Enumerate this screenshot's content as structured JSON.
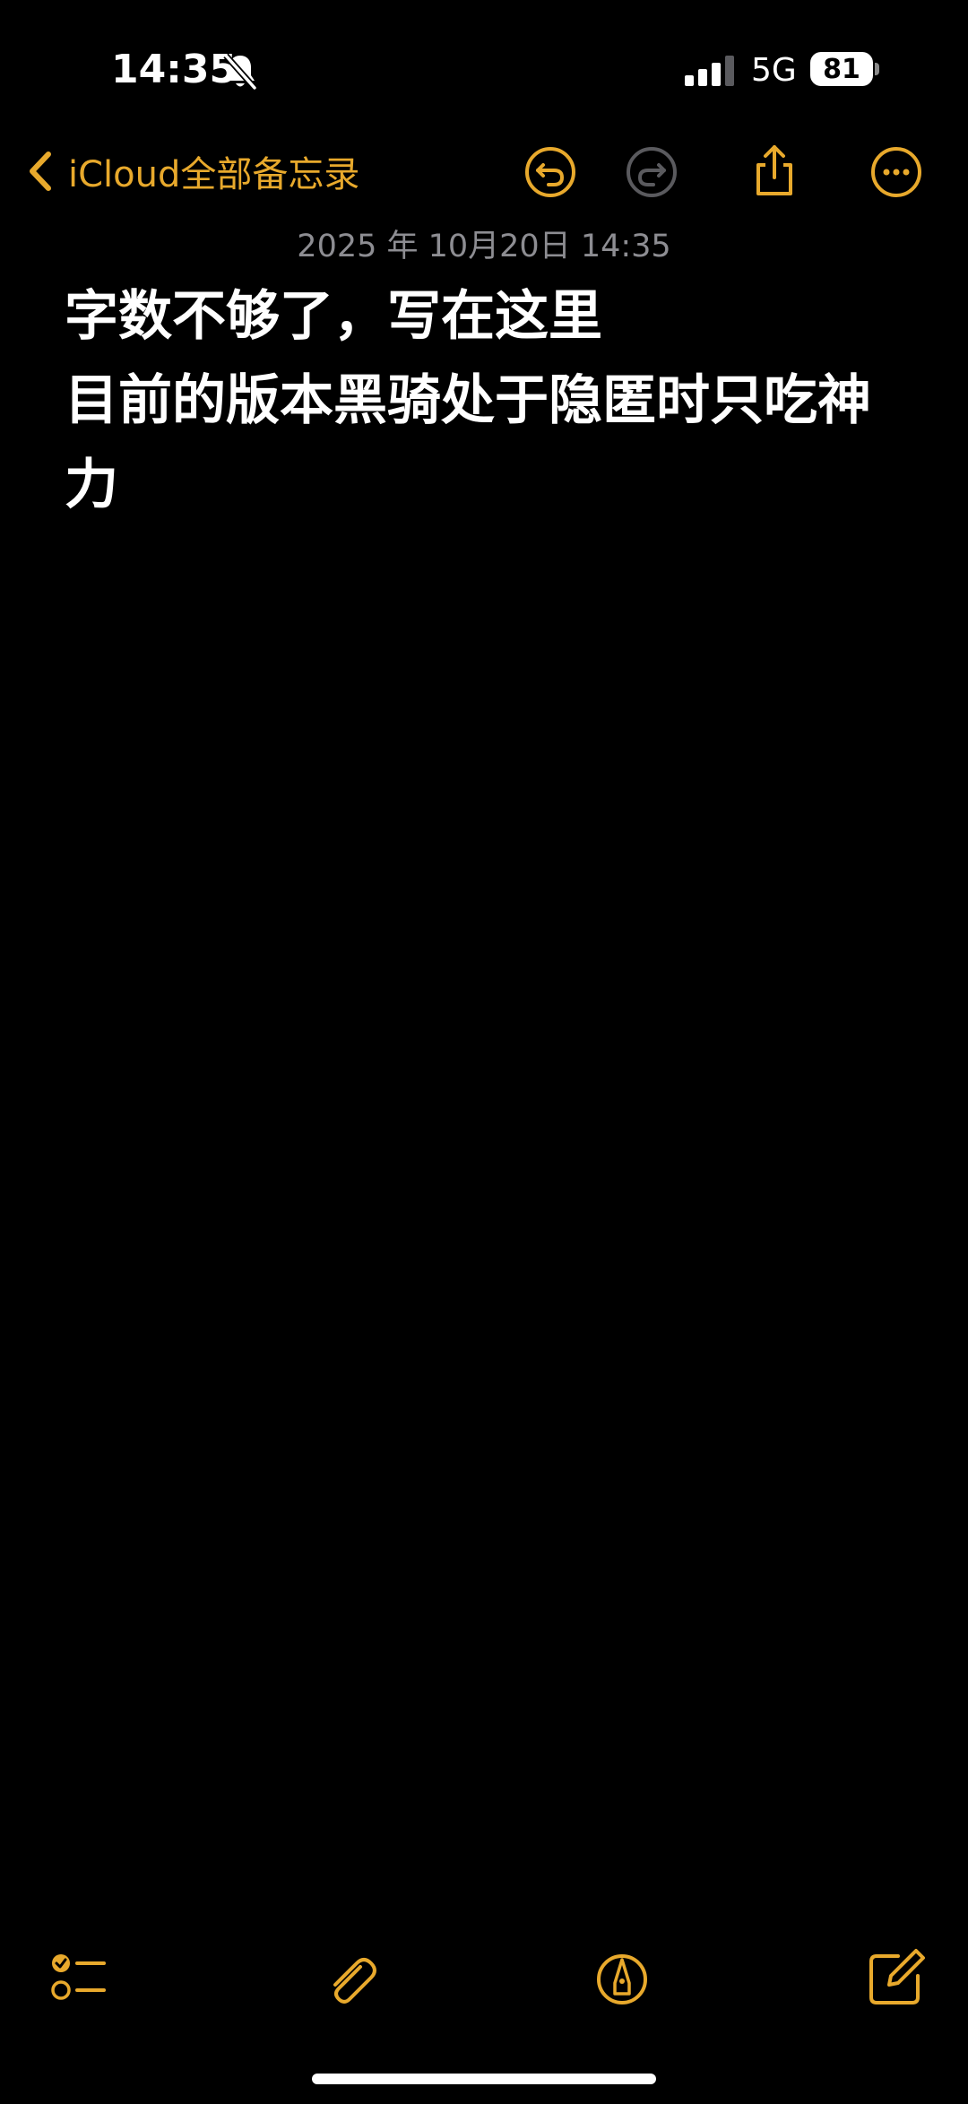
{
  "status_bar": {
    "time": "14:35",
    "network": "5G",
    "battery": "81",
    "icons": [
      "bell-slash-icon",
      "cellular-signal-icon",
      "battery-icon"
    ]
  },
  "nav": {
    "back_label": "iCloud全部备忘录",
    "icons": [
      "chevron-left-icon",
      "undo-icon",
      "redo-icon",
      "share-icon",
      "more-icon"
    ]
  },
  "note": {
    "date": "2025 年 10月20日 14:35",
    "lines": [
      "字数不够了，写在这里",
      "目前的版本黑骑处于隐匿时只吃神力"
    ]
  },
  "toolbar": {
    "icons": [
      "checklist-icon",
      "paperclip-icon",
      "markup-pen-icon",
      "compose-icon"
    ]
  },
  "colors": {
    "accent": "#e8a92c",
    "background": "#000000",
    "text": "#ffffff",
    "secondary_text": "#8d8d92",
    "disabled_icon": "#5a5a5e"
  }
}
